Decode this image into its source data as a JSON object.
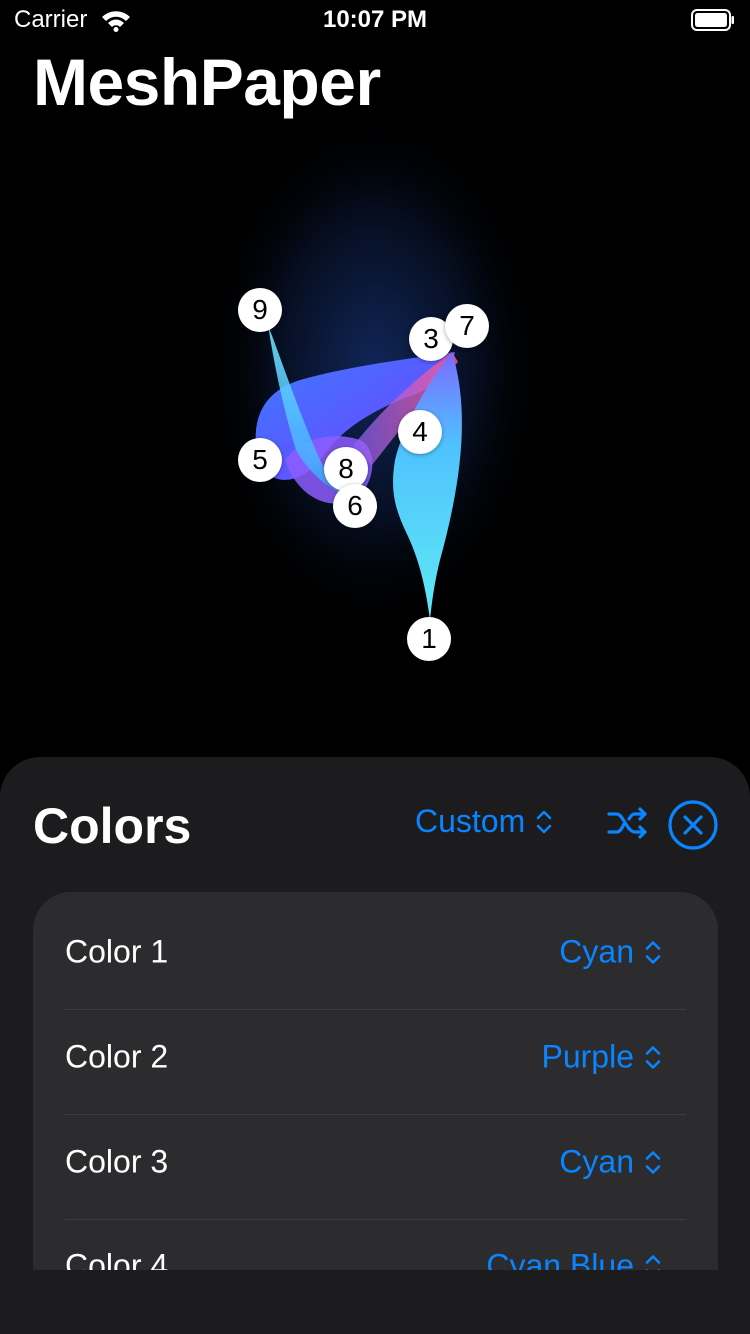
{
  "status_bar": {
    "carrier": "Carrier",
    "time": "10:07 PM",
    "icons": [
      "wifi-icon",
      "battery-icon"
    ]
  },
  "app": {
    "title": "MeshPaper"
  },
  "mesh": {
    "handles": [
      "9",
      "3",
      "7",
      "4",
      "5",
      "8",
      "6",
      "1"
    ]
  },
  "colors_sheet": {
    "title": "Colors",
    "preset": "Custom",
    "icons": [
      "chevron-updown-icon",
      "shuffle-icon",
      "close-circle-icon"
    ],
    "accent_color": "#0a84ff",
    "rows": [
      {
        "label": "Color 1",
        "value": "Cyan"
      },
      {
        "label": "Color 2",
        "value": "Purple"
      },
      {
        "label": "Color 3",
        "value": "Cyan"
      },
      {
        "label": "Color 4",
        "value": "Cyan Blue"
      }
    ]
  }
}
